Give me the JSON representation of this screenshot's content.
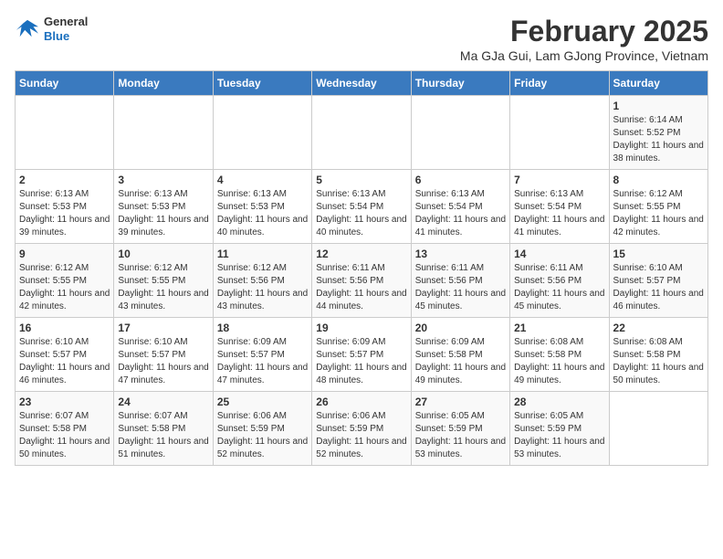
{
  "header": {
    "logo": {
      "general": "General",
      "blue": "Blue"
    },
    "title": "February 2025",
    "subtitle": "Ma GJa Gui, Lam GJong Province, Vietnam"
  },
  "calendar": {
    "weekdays": [
      "Sunday",
      "Monday",
      "Tuesday",
      "Wednesday",
      "Thursday",
      "Friday",
      "Saturday"
    ],
    "weeks": [
      [
        {
          "day": "",
          "info": ""
        },
        {
          "day": "",
          "info": ""
        },
        {
          "day": "",
          "info": ""
        },
        {
          "day": "",
          "info": ""
        },
        {
          "day": "",
          "info": ""
        },
        {
          "day": "",
          "info": ""
        },
        {
          "day": "1",
          "info": "Sunrise: 6:14 AM\nSunset: 5:52 PM\nDaylight: 11 hours and 38 minutes."
        }
      ],
      [
        {
          "day": "2",
          "info": "Sunrise: 6:13 AM\nSunset: 5:53 PM\nDaylight: 11 hours and 39 minutes."
        },
        {
          "day": "3",
          "info": "Sunrise: 6:13 AM\nSunset: 5:53 PM\nDaylight: 11 hours and 39 minutes."
        },
        {
          "day": "4",
          "info": "Sunrise: 6:13 AM\nSunset: 5:53 PM\nDaylight: 11 hours and 40 minutes."
        },
        {
          "day": "5",
          "info": "Sunrise: 6:13 AM\nSunset: 5:54 PM\nDaylight: 11 hours and 40 minutes."
        },
        {
          "day": "6",
          "info": "Sunrise: 6:13 AM\nSunset: 5:54 PM\nDaylight: 11 hours and 41 minutes."
        },
        {
          "day": "7",
          "info": "Sunrise: 6:13 AM\nSunset: 5:54 PM\nDaylight: 11 hours and 41 minutes."
        },
        {
          "day": "8",
          "info": "Sunrise: 6:12 AM\nSunset: 5:55 PM\nDaylight: 11 hours and 42 minutes."
        }
      ],
      [
        {
          "day": "9",
          "info": "Sunrise: 6:12 AM\nSunset: 5:55 PM\nDaylight: 11 hours and 42 minutes."
        },
        {
          "day": "10",
          "info": "Sunrise: 6:12 AM\nSunset: 5:55 PM\nDaylight: 11 hours and 43 minutes."
        },
        {
          "day": "11",
          "info": "Sunrise: 6:12 AM\nSunset: 5:56 PM\nDaylight: 11 hours and 43 minutes."
        },
        {
          "day": "12",
          "info": "Sunrise: 6:11 AM\nSunset: 5:56 PM\nDaylight: 11 hours and 44 minutes."
        },
        {
          "day": "13",
          "info": "Sunrise: 6:11 AM\nSunset: 5:56 PM\nDaylight: 11 hours and 45 minutes."
        },
        {
          "day": "14",
          "info": "Sunrise: 6:11 AM\nSunset: 5:56 PM\nDaylight: 11 hours and 45 minutes."
        },
        {
          "day": "15",
          "info": "Sunrise: 6:10 AM\nSunset: 5:57 PM\nDaylight: 11 hours and 46 minutes."
        }
      ],
      [
        {
          "day": "16",
          "info": "Sunrise: 6:10 AM\nSunset: 5:57 PM\nDaylight: 11 hours and 46 minutes."
        },
        {
          "day": "17",
          "info": "Sunrise: 6:10 AM\nSunset: 5:57 PM\nDaylight: 11 hours and 47 minutes."
        },
        {
          "day": "18",
          "info": "Sunrise: 6:09 AM\nSunset: 5:57 PM\nDaylight: 11 hours and 47 minutes."
        },
        {
          "day": "19",
          "info": "Sunrise: 6:09 AM\nSunset: 5:57 PM\nDaylight: 11 hours and 48 minutes."
        },
        {
          "day": "20",
          "info": "Sunrise: 6:09 AM\nSunset: 5:58 PM\nDaylight: 11 hours and 49 minutes."
        },
        {
          "day": "21",
          "info": "Sunrise: 6:08 AM\nSunset: 5:58 PM\nDaylight: 11 hours and 49 minutes."
        },
        {
          "day": "22",
          "info": "Sunrise: 6:08 AM\nSunset: 5:58 PM\nDaylight: 11 hours and 50 minutes."
        }
      ],
      [
        {
          "day": "23",
          "info": "Sunrise: 6:07 AM\nSunset: 5:58 PM\nDaylight: 11 hours and 50 minutes."
        },
        {
          "day": "24",
          "info": "Sunrise: 6:07 AM\nSunset: 5:58 PM\nDaylight: 11 hours and 51 minutes."
        },
        {
          "day": "25",
          "info": "Sunrise: 6:06 AM\nSunset: 5:59 PM\nDaylight: 11 hours and 52 minutes."
        },
        {
          "day": "26",
          "info": "Sunrise: 6:06 AM\nSunset: 5:59 PM\nDaylight: 11 hours and 52 minutes."
        },
        {
          "day": "27",
          "info": "Sunrise: 6:05 AM\nSunset: 5:59 PM\nDaylight: 11 hours and 53 minutes."
        },
        {
          "day": "28",
          "info": "Sunrise: 6:05 AM\nSunset: 5:59 PM\nDaylight: 11 hours and 53 minutes."
        },
        {
          "day": "",
          "info": ""
        }
      ]
    ]
  }
}
